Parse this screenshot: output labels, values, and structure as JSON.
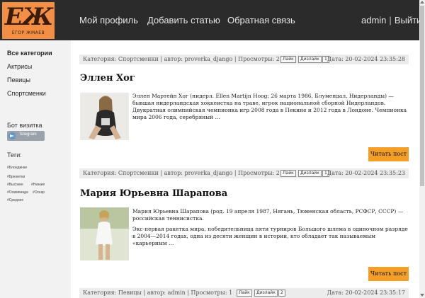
{
  "header": {
    "logo_mark": "ЕЖ",
    "logo_sub": "ЕГОР ЖМАЕВ",
    "nav": [
      "Мой профиль",
      "Добавить статью",
      "Обратная связь"
    ],
    "user": "admin",
    "separator": "|",
    "logout": "Выйти"
  },
  "sidebar": {
    "categories": [
      {
        "label": "Все категории",
        "active": true
      },
      {
        "label": "Актрисы",
        "active": false
      },
      {
        "label": "Певицы",
        "active": false
      },
      {
        "label": "Спортсменки",
        "active": false
      }
    ],
    "bot_label": "Бот визитка",
    "telegram_label": "Telegram",
    "tags_title": "Теги:",
    "tags": [
      "#Блондинки",
      "#Брюнетки",
      "#Высокие",
      "#Низкие",
      "#Олимпиада",
      "#Оскар",
      "#Средние"
    ]
  },
  "posts": [
    {
      "meta": "Категория: Спортсменки | автор: proverka_django | Просмотры: 2",
      "like": "Лайк",
      "dislike": "Дизлайк",
      "score": "1",
      "date": "Дата: 20-02-2024 23:35:28",
      "title": "Эллен Хог",
      "paragraphs": [
        "Эллен Мартейн Хог (нидерл. Ellen Martijn Hoog; 26 марта 1986, Блумендал, Нидерланды) — бывшая нидерландская хоккеистка на траве, игрок национальной сборной Нидерландов. Двукратная олимпийская чемпионка игр 2008 года в Пекине и 2012 года в Лондоне. Чемпионка мира 2006 года, серебряный …"
      ],
      "read_more": "Читать пост"
    },
    {
      "meta": "Категория: Спортсменки | автор: proverka_django | Просмотры: 2",
      "like": "Лайк",
      "dislike": "Дизлайк",
      "score": "1",
      "date": "Дата: 20-02-2024 23:35:23",
      "title": "Мария Юрьевна Шарапова",
      "paragraphs": [
        "Мария Юрьевна Шарапова (род. 19 апреля 1987, Нягань, Тюменская область, РСФСР, СССР) — российская теннисистка.",
        "Экс-первая ракетка мира, победительница пяти турниров Большого шлема в одиночном разряде в 2004—2014 годах, одна из десяти женщин в истории, кто обладает так называемым «карьерным …"
      ],
      "read_more": "Читать пост"
    },
    {
      "meta": "Категория: Певицы | автор: admin | Просмотры: 1",
      "like": "Лайк",
      "dislike": "Дизлайк",
      "score": "2",
      "date": "Дата: 20-02-2024 23:35:17"
    }
  ]
}
